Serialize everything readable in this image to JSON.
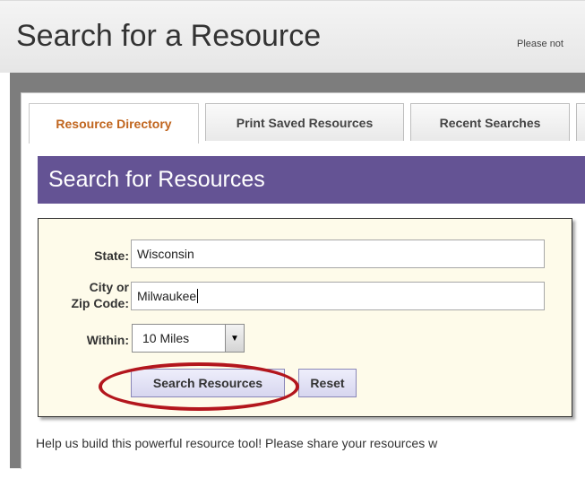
{
  "header": {
    "title": "Search for a Resource",
    "note": "Please not"
  },
  "tabs": [
    {
      "label": "Resource Directory",
      "active": true
    },
    {
      "label": "Print Saved Resources",
      "active": false
    },
    {
      "label": "Recent Searches",
      "active": false
    }
  ],
  "section": {
    "title": "Search for Resources"
  },
  "form": {
    "state_label": "State:",
    "state_value": "Wisconsin",
    "city_label_line1": "City or",
    "city_label_line2": "Zip Code:",
    "city_value": "Milwaukee",
    "within_label": "Within:",
    "within_value": "10 Miles",
    "search_button": "Search Resources",
    "reset_button": "Reset"
  },
  "help_text": "Help us build this powerful resource tool! Please share your resources w",
  "colors": {
    "section_bar": "#645394",
    "active_tab_text": "#c0651e",
    "form_background": "#fefbea",
    "annotation_circle": "#b3161d"
  }
}
